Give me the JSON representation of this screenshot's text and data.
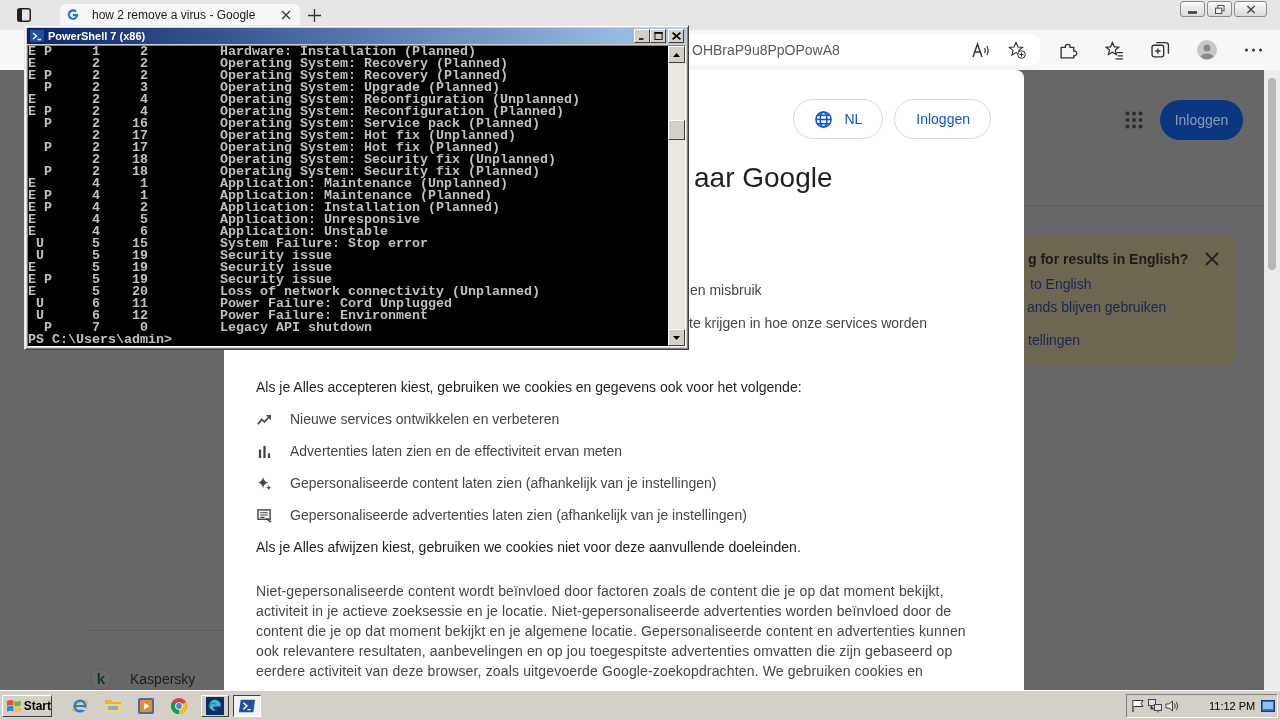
{
  "browser": {
    "tabs": [
      {
        "title": "how 2 remove a virus - Google",
        "selected": true
      }
    ],
    "address_bar": {
      "url": "OHBraP9u8PpOPowA8"
    }
  },
  "page": {
    "sign_in_button": "Inloggen",
    "language_banner": {
      "title": "g for results in English?",
      "links": [
        "to English",
        "ands blijven gebruiken",
        "tellingen"
      ]
    },
    "result": {
      "logo_letter": "k",
      "site": "Kaspersky"
    }
  },
  "consent_dialog": {
    "language_button": "NL",
    "sign_in_button": "Inloggen",
    "title": "aar Google",
    "partial_lines": [
      "en misbruik",
      "te krijgen in hoe onze services worden"
    ],
    "accept_intro": "Als je Alles accepteren kiest, gebruiken we cookies en gegevens ook voor het volgende:",
    "purposes": [
      {
        "kind": "trend",
        "text": "Nieuwe services ontwikkelen en verbeteren"
      },
      {
        "kind": "bars",
        "text": "Advertenties laten zien en de effectiviteit ervan meten"
      },
      {
        "kind": "sparkle",
        "text": "Gepersonaliseerde content laten zien (afhankelijk van je instellingen)"
      },
      {
        "kind": "ad",
        "text": "Gepersonaliseerde advertenties laten zien (afhankelijk van je instellingen)"
      }
    ],
    "reject_note": "Als je Alles afwijzen kiest, gebruiken we cookies niet voor deze aanvullende doeleinden.",
    "details": "Niet-gepersonaliseerde content wordt beïnvloed door factoren zoals de content die je op dat moment bekijkt, activiteit in je actieve zoeksessie en je locatie. Niet-gepersonaliseerde advertenties worden beïnvloed door de content die je op dat moment bekijkt en je algemene locatie. Gepersonaliseerde content en advertenties kunnen ook relevantere resultaten, aanbevelingen en op jou toegespitste advertenties omvatten die zijn gebaseerd op eerdere activiteit van deze browser, zoals uitgevoerde Google-zoekopdrachten. We gebruiken cookies en"
  },
  "console": {
    "title": "PowerShell 7 (x86)",
    "rows": [
      {
        "column_1": "E",
        "column_3": "P",
        "column_4": "1",
        "column_5": "2",
        "column_6": "Hardware: Installation (Planned)"
      },
      {
        "column_1": "E",
        "column_4": "2",
        "column_5": "2",
        "column_6": "Operating System: Recovery (Planned)"
      },
      {
        "column_1": "E",
        "column_3": "P",
        "column_4": "2",
        "column_5": "2",
        "column_6": "Operating System: Recovery (Planned)"
      },
      {
        "column_3": "P",
        "column_4": "2",
        "column_5": "3",
        "column_6": "Operating System: Upgrade (Planned)"
      },
      {
        "column_1": "E",
        "column_4": "2",
        "column_5": "4",
        "column_6": "Operating System: Reconfiguration (Unplanned)"
      },
      {
        "column_1": "E",
        "column_3": "P",
        "column_4": "2",
        "column_5": "4",
        "column_6": "Operating System: Reconfiguration (Planned)"
      },
      {
        "column_3": "P",
        "column_4": "2",
        "column_5": "16",
        "column_6": "Operating System: Service pack (Planned)"
      },
      {
        "column_4": "2",
        "column_5": "17",
        "column_6": "Operating System: Hot fix (Unplanned)"
      },
      {
        "column_3": "P",
        "column_4": "2",
        "column_5": "17",
        "column_6": "Operating System: Hot fix (Planned)"
      },
      {
        "column_4": "2",
        "column_5": "18",
        "column_6": "Operating System: Security fix (Unplanned)"
      },
      {
        "column_3": "P",
        "column_4": "2",
        "column_5": "18",
        "column_6": "Operating System: Security fix (Planned)"
      },
      {
        "column_1": "E",
        "column_4": "4",
        "column_5": "1",
        "column_6": "Application: Maintenance (Unplanned)"
      },
      {
        "column_1": "E",
        "column_3": "P",
        "column_4": "4",
        "column_5": "1",
        "column_6": "Application: Maintenance (Planned)"
      },
      {
        "column_1": "E",
        "column_3": "P",
        "column_4": "4",
        "column_5": "2",
        "column_6": "Application: Installation (Planned)"
      },
      {
        "column_1": "E",
        "column_4": "4",
        "column_5": "5",
        "column_6": "Application: Unresponsive"
      },
      {
        "column_1": "E",
        "column_4": "4",
        "column_5": "6",
        "column_6": "Application: Unstable"
      },
      {
        "column_2": "U",
        "column_4": "5",
        "column_5": "15",
        "column_6": "System Failure: Stop error"
      },
      {
        "column_2": "U",
        "column_4": "5",
        "column_5": "19",
        "column_6": "Security issue"
      },
      {
        "column_1": "E",
        "column_4": "5",
        "column_5": "19",
        "column_6": "Security issue"
      },
      {
        "column_1": "E",
        "column_3": "P",
        "column_4": "5",
        "column_5": "19",
        "column_6": "Security issue"
      },
      {
        "column_1": "E",
        "column_4": "5",
        "column_5": "20",
        "column_6": "Loss of network connectivity (Unplanned)"
      },
      {
        "column_2": "U",
        "column_4": "6",
        "column_5": "11",
        "column_6": "Power Failure: Cord Unplugged"
      },
      {
        "column_2": "U",
        "column_4": "6",
        "column_5": "12",
        "column_6": "Power Failure: Environment"
      },
      {
        "column_3": "P",
        "column_4": "7",
        "column_5": "0",
        "column_6": "Legacy API shutdown"
      }
    ],
    "prompt": "PS C:\\Users\\admin>"
  },
  "taskbar": {
    "start_button": "Start",
    "quick_launch": [
      {
        "kind": "letter_e"
      },
      {
        "kind": "folder"
      },
      {
        "kind": "player"
      },
      {
        "kind": "ring"
      }
    ],
    "windows": [
      {
        "kind": "swirl",
        "selected": false
      },
      {
        "kind": "prompt",
        "selected": true
      }
    ],
    "clock": "11:12 PM"
  }
}
